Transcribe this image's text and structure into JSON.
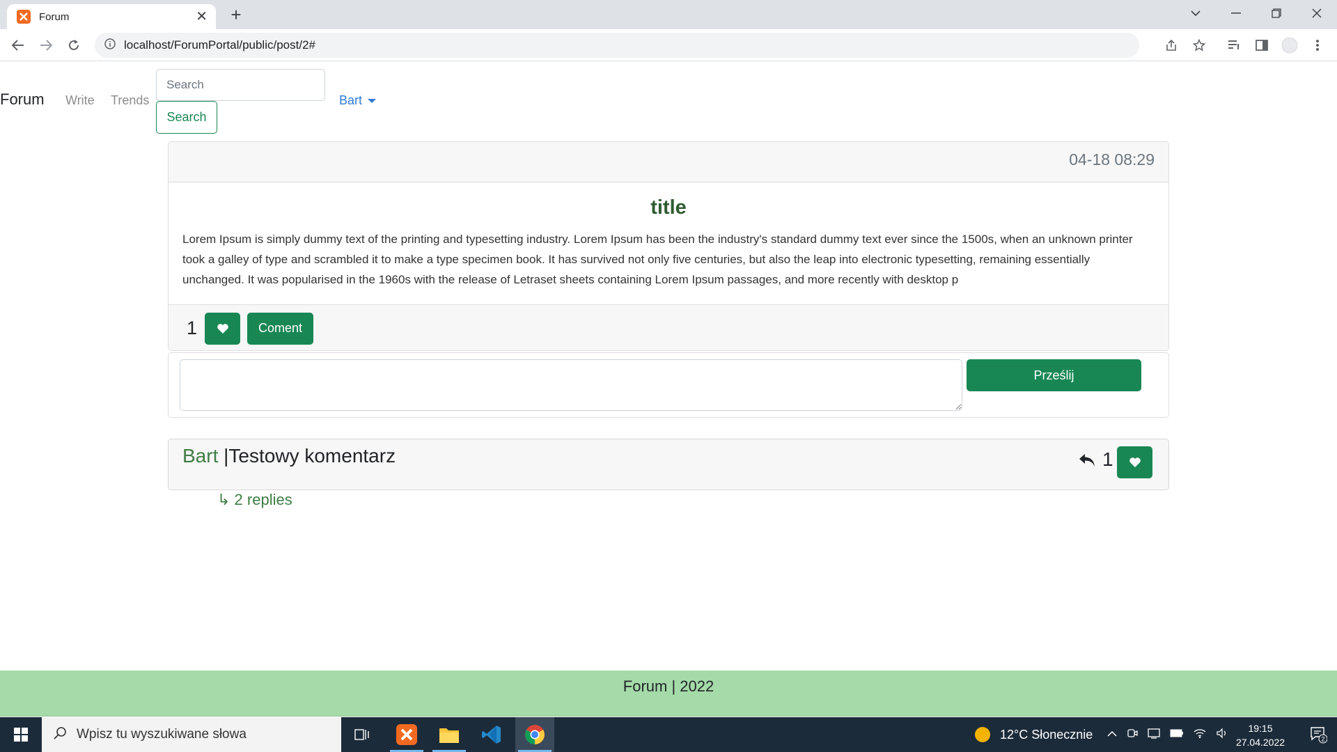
{
  "browser": {
    "tab_title": "Forum",
    "url": "localhost/ForumPortal/public/post/2#"
  },
  "navbar": {
    "brand": "Forum",
    "links": [
      "Write",
      "Trends"
    ],
    "search_placeholder": "Search",
    "search_button": "Search",
    "user": "Bart"
  },
  "post": {
    "date": "04-18 08:29",
    "title": "title",
    "body": "Lorem Ipsum is simply dummy text of the printing and typesetting industry. Lorem Ipsum has been the industry's standard dummy text ever since the 1500s, when an unknown printer took a galley of type and scrambled it to make a type specimen book. It has survived not only five centuries, but also the leap into electronic typesetting, remaining essentially unchanged. It was popularised in the 1960s with the release of Letraset sheets containing Lorem Ipsum passages, and more recently with desktop p",
    "likes": "1",
    "comment_button": "Coment"
  },
  "comment_form": {
    "submit": "Prześlij"
  },
  "comment": {
    "author": "Bart",
    "separator": " |",
    "text": "Testowy komentarz",
    "likes": "1",
    "replies": "↳ 2 replies"
  },
  "footer": {
    "text": "Forum | 2022"
  },
  "taskbar": {
    "search_placeholder": "Wpisz tu wyszukiwane słowa",
    "weather": "12°C  Słonecznie",
    "time": "19:15",
    "date": "27.04.2022",
    "notifications": "2"
  },
  "colors": {
    "primary_green": "#198754",
    "footer_green": "#a5dba9",
    "link_blue": "#2f7bd6"
  }
}
